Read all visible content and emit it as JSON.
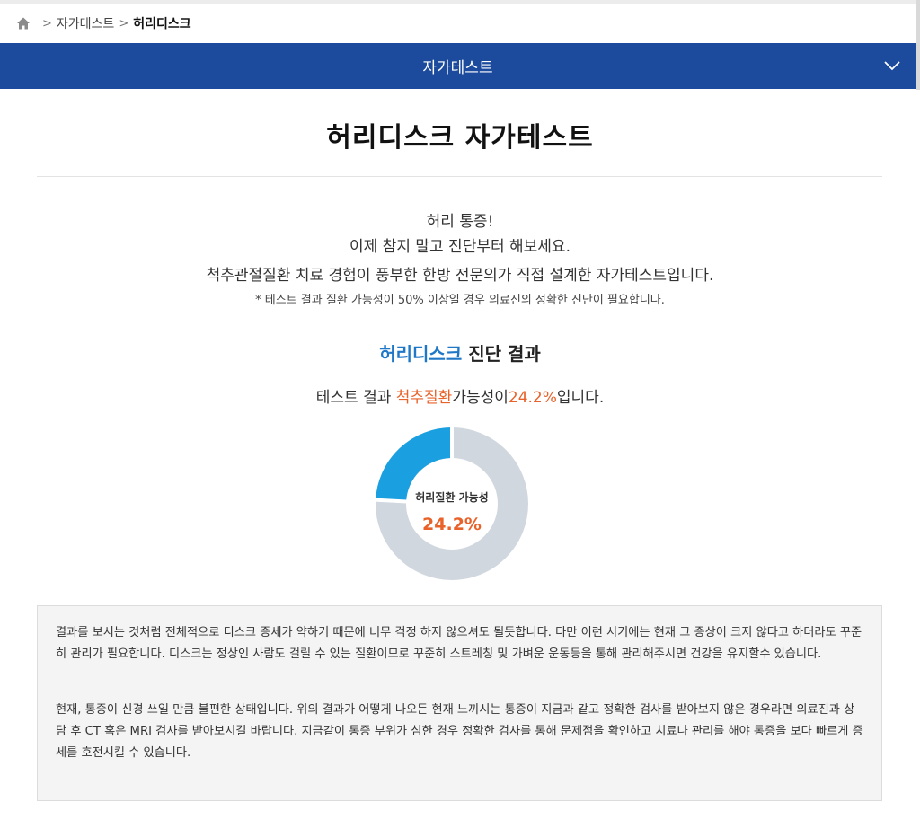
{
  "breadcrumb": {
    "home_icon": "home-icon",
    "items": [
      "자가테스트",
      "허리디스크"
    ]
  },
  "category_bar": {
    "label": "자가테스트",
    "icon": "chevron-down-icon",
    "color": "#1c4b9e"
  },
  "page": {
    "title": "허리디스크 자가테스트"
  },
  "intro": {
    "line1": "허리 통증!",
    "line2": "이제 참지 말고 진단부터 해보세요.",
    "line3": "척추관절질환 치료 경험이 풍부한 한방 전문의가 직접 설계한 자가테스트입니다.",
    "note": "* 테스트 결과 질환 가능성이 50% 이상일 경우 의료진의 정확한 진단이 필요합니다."
  },
  "result": {
    "heading_highlight": "허리디스크",
    "heading_rest": " 진단 결과",
    "line_prefix": "테스트 결과 ",
    "line_disease": "척추질환",
    "line_middle": "가능성이",
    "line_percent": "24.2%",
    "line_suffix": "입니다.",
    "donut_label": "허리질환 가능성",
    "donut_value": "24.2%",
    "probability_fraction": 0.242,
    "colors": {
      "filled": "#1aa0e1",
      "remaining": "#d1d7df",
      "highlight_text": "#1f77c7",
      "orange_text": "#e8622a"
    }
  },
  "description": {
    "paragraph1": "결과를 보시는 것처럼 전체적으로 디스크 증세가 약하기 때문에 너무 걱정 하지 않으셔도 될듯합니다. 다만 이런 시기에는 현재 그 증상이 크지 않다고 하더라도 꾸준히 관리가 필요합니다. 디스크는 정상인 사람도 걸릴 수 있는 질환이므로 꾸준히 스트레칭 및 가벼운 운동등을 통해 관리해주시면 건강을 유지할수 있습니다.",
    "paragraph2": "현재, 통증이 신경 쓰일 만큼 불편한 상태입니다. 위의 결과가 어떻게 나오든 현재 느끼시는 통증이 지금과 같고 정확한 검사를 받아보지 않은 경우라면 의료진과 상담 후 CT 혹은 MRI 검사를 받아보시길 바랍니다. 지금같이 통증 부위가 심한 경우 정확한 검사를 통해 문제점을 확인하고 치료나 관리를 해야 통증을 보다 빠르게 증세를 호전시킬 수 있습니다."
  }
}
